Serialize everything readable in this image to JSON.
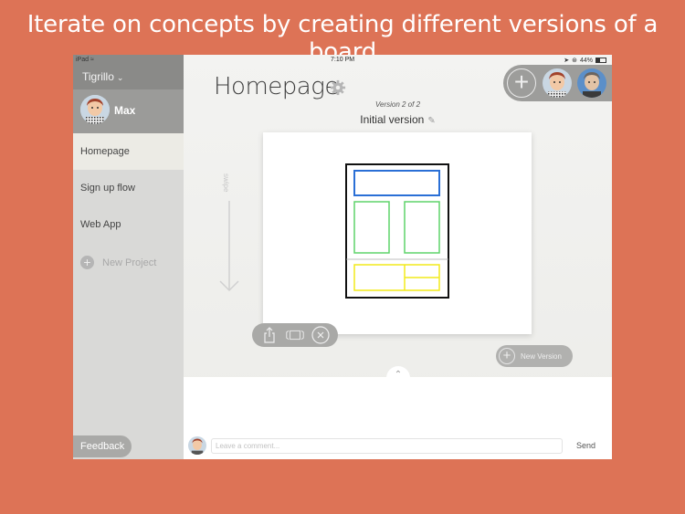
{
  "headline": "Iterate on concepts by creating different versions of a board",
  "status_bar": {
    "device": "iPad",
    "wifi_icon": "wifi-icon",
    "time": "7:10 PM",
    "location_icon": "location-arrow-icon",
    "bluetooth_icon": "bluetooth-icon",
    "battery_percent": "44%",
    "battery_level": 0.44
  },
  "sidebar": {
    "team_name": "Tigrillo",
    "team_chevron": "chevron-down-icon",
    "user_name": "Max",
    "items": [
      {
        "label": "Homepage",
        "active": true
      },
      {
        "label": "Sign up flow",
        "active": false
      },
      {
        "label": "Web App",
        "active": false
      }
    ],
    "new_project_label": "New Project",
    "feedback_label": "Feedback"
  },
  "main": {
    "title": "Homepage",
    "settings_icon": "gear-icon",
    "version_counter": "Version 2 of 2",
    "version_name": "Initial version",
    "swipe_label": "swipe",
    "collaborators": [
      "Max",
      "Collaborator"
    ],
    "add_collaborator_icon": "plus-icon",
    "board_toolbar": [
      "share-icon",
      "present-icon",
      "close-icon"
    ],
    "new_version_label": "New Version",
    "sketch_colors": {
      "frame": "#111111",
      "header": "#2a6fd6",
      "content": "#5fd46a",
      "footer": "#f2ea1a"
    }
  },
  "comments": {
    "placeholder": "Leave a comment...",
    "value": "",
    "send_label": "Send"
  },
  "colors": {
    "background": "#dd7356",
    "sidebar": "#d9d9d7",
    "active_item": "#ecebe5"
  }
}
